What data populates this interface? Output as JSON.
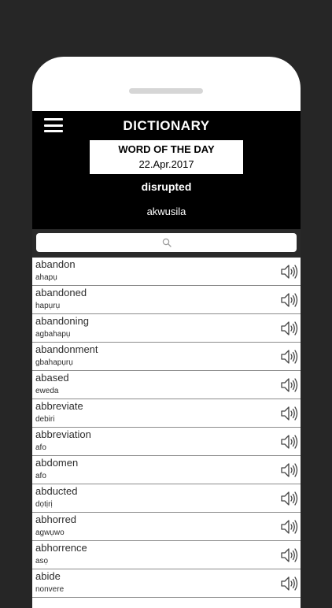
{
  "header": {
    "title": "DICTIONARY"
  },
  "word_of_day": {
    "heading": "WORD OF THE DAY",
    "date": "22.Apr.2017",
    "word": "disrupted",
    "translation": "akwusila"
  },
  "search": {
    "placeholder": ""
  },
  "entries": [
    {
      "word": "abandon",
      "translation": "ahapụ"
    },
    {
      "word": "abandoned",
      "translation": "hapụrụ"
    },
    {
      "word": "abandoning",
      "translation": "agbahapụ"
    },
    {
      "word": "abandonment",
      "translation": "gbahapụrụ"
    },
    {
      "word": "abased",
      "translation": "eweda"
    },
    {
      "word": "abbreviate",
      "translation": "debiri"
    },
    {
      "word": "abbreviation",
      "translation": "afo"
    },
    {
      "word": "abdomen",
      "translation": "afo"
    },
    {
      "word": "abducted",
      "translation": "dọtịrị"
    },
    {
      "word": "abhorred",
      "translation": "agwụwo"
    },
    {
      "word": "abhorrence",
      "translation": "asọ"
    },
    {
      "word": "abide",
      "translation": "nonvere"
    }
  ]
}
